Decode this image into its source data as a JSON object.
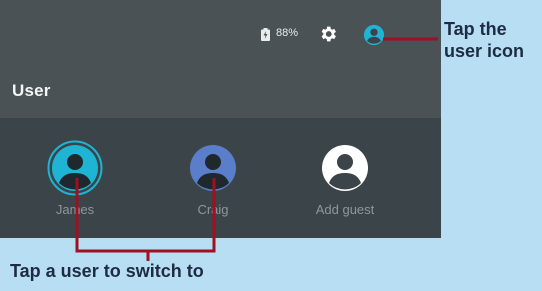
{
  "status_bar": {
    "battery_icon": "battery-charging-icon",
    "battery_percent": "88%",
    "settings_icon": "gear-icon",
    "user_icon": "account-circle-icon"
  },
  "panel": {
    "title": "User"
  },
  "users": [
    {
      "name": "James",
      "icon": "account-circle-icon",
      "avatar_color": "#1fb4d4",
      "selected": true
    },
    {
      "name": "Craig",
      "icon": "account-circle-icon",
      "avatar_color": "#5a7ec9",
      "selected": false
    },
    {
      "name": "Add guest",
      "icon": "account-circle-icon",
      "avatar_color": "#ffffff",
      "selected": false
    }
  ],
  "callouts": {
    "user_icon": [
      "Tap the",
      "user icon"
    ],
    "switch_user": "Tap a user to switch to"
  },
  "colors": {
    "callout_line": "#a01020",
    "callout_text": "#1d2b43",
    "background": "#b7def2",
    "accent": "#1fb4d4"
  }
}
